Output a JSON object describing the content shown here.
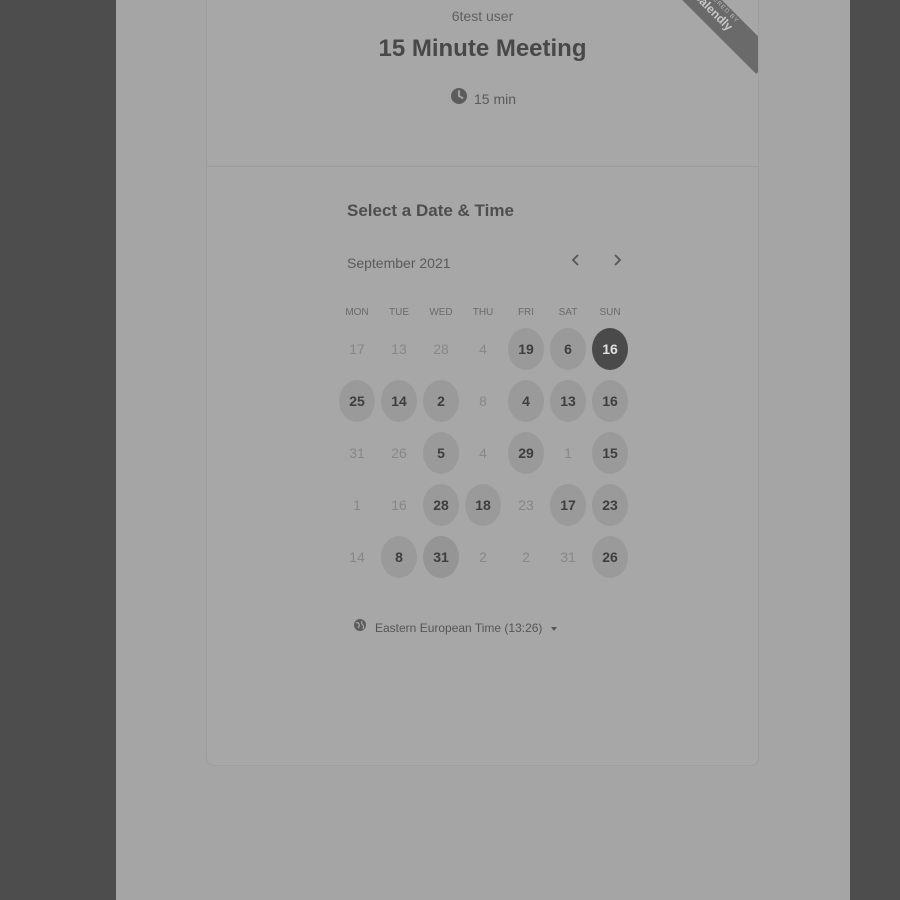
{
  "host_name": "6test user",
  "event_title": "15 Minute Meeting",
  "duration": "15 min",
  "ribbon": {
    "small": "POWERED BY",
    "brand": "Calendly"
  },
  "section_title": "Select a Date & Time",
  "month_label": "September 2021",
  "weekdays": [
    "MON",
    "TUE",
    "WED",
    "THU",
    "FRI",
    "SAT",
    "SUN"
  ],
  "days": [
    {
      "label": "17",
      "state": "unavailable"
    },
    {
      "label": "13",
      "state": "unavailable"
    },
    {
      "label": "28",
      "state": "unavailable"
    },
    {
      "label": "4",
      "state": "unavailable"
    },
    {
      "label": "19",
      "state": "available"
    },
    {
      "label": "6",
      "state": "available"
    },
    {
      "label": "16",
      "state": "today"
    },
    {
      "label": "25",
      "state": "available"
    },
    {
      "label": "14",
      "state": "available"
    },
    {
      "label": "2",
      "state": "available"
    },
    {
      "label": "8",
      "state": "unavailable"
    },
    {
      "label": "4",
      "state": "available"
    },
    {
      "label": "13",
      "state": "available"
    },
    {
      "label": "16",
      "state": "available"
    },
    {
      "label": "31",
      "state": "unavailable"
    },
    {
      "label": "26",
      "state": "unavailable"
    },
    {
      "label": "5",
      "state": "available"
    },
    {
      "label": "4",
      "state": "unavailable"
    },
    {
      "label": "29",
      "state": "available"
    },
    {
      "label": "1",
      "state": "unavailable"
    },
    {
      "label": "15",
      "state": "available"
    },
    {
      "label": "1",
      "state": "unavailable"
    },
    {
      "label": "16",
      "state": "unavailable"
    },
    {
      "label": "28",
      "state": "available"
    },
    {
      "label": "18",
      "state": "available"
    },
    {
      "label": "23",
      "state": "unavailable"
    },
    {
      "label": "17",
      "state": "available"
    },
    {
      "label": "23",
      "state": "available"
    },
    {
      "label": "14",
      "state": "unavailable"
    },
    {
      "label": "8",
      "state": "available"
    },
    {
      "label": "31",
      "state": "selected"
    },
    {
      "label": "2",
      "state": "unavailable"
    },
    {
      "label": "2",
      "state": "unavailable"
    },
    {
      "label": "31",
      "state": "unavailable"
    },
    {
      "label": "26",
      "state": "available"
    }
  ],
  "timezone": "Eastern European Time (13:26)",
  "icons": {
    "duration": "clock-icon",
    "prev": "chevron-left-icon",
    "next": "chevron-right-icon",
    "timezone": "globe-icon",
    "dropdown": "caret-down-icon"
  }
}
